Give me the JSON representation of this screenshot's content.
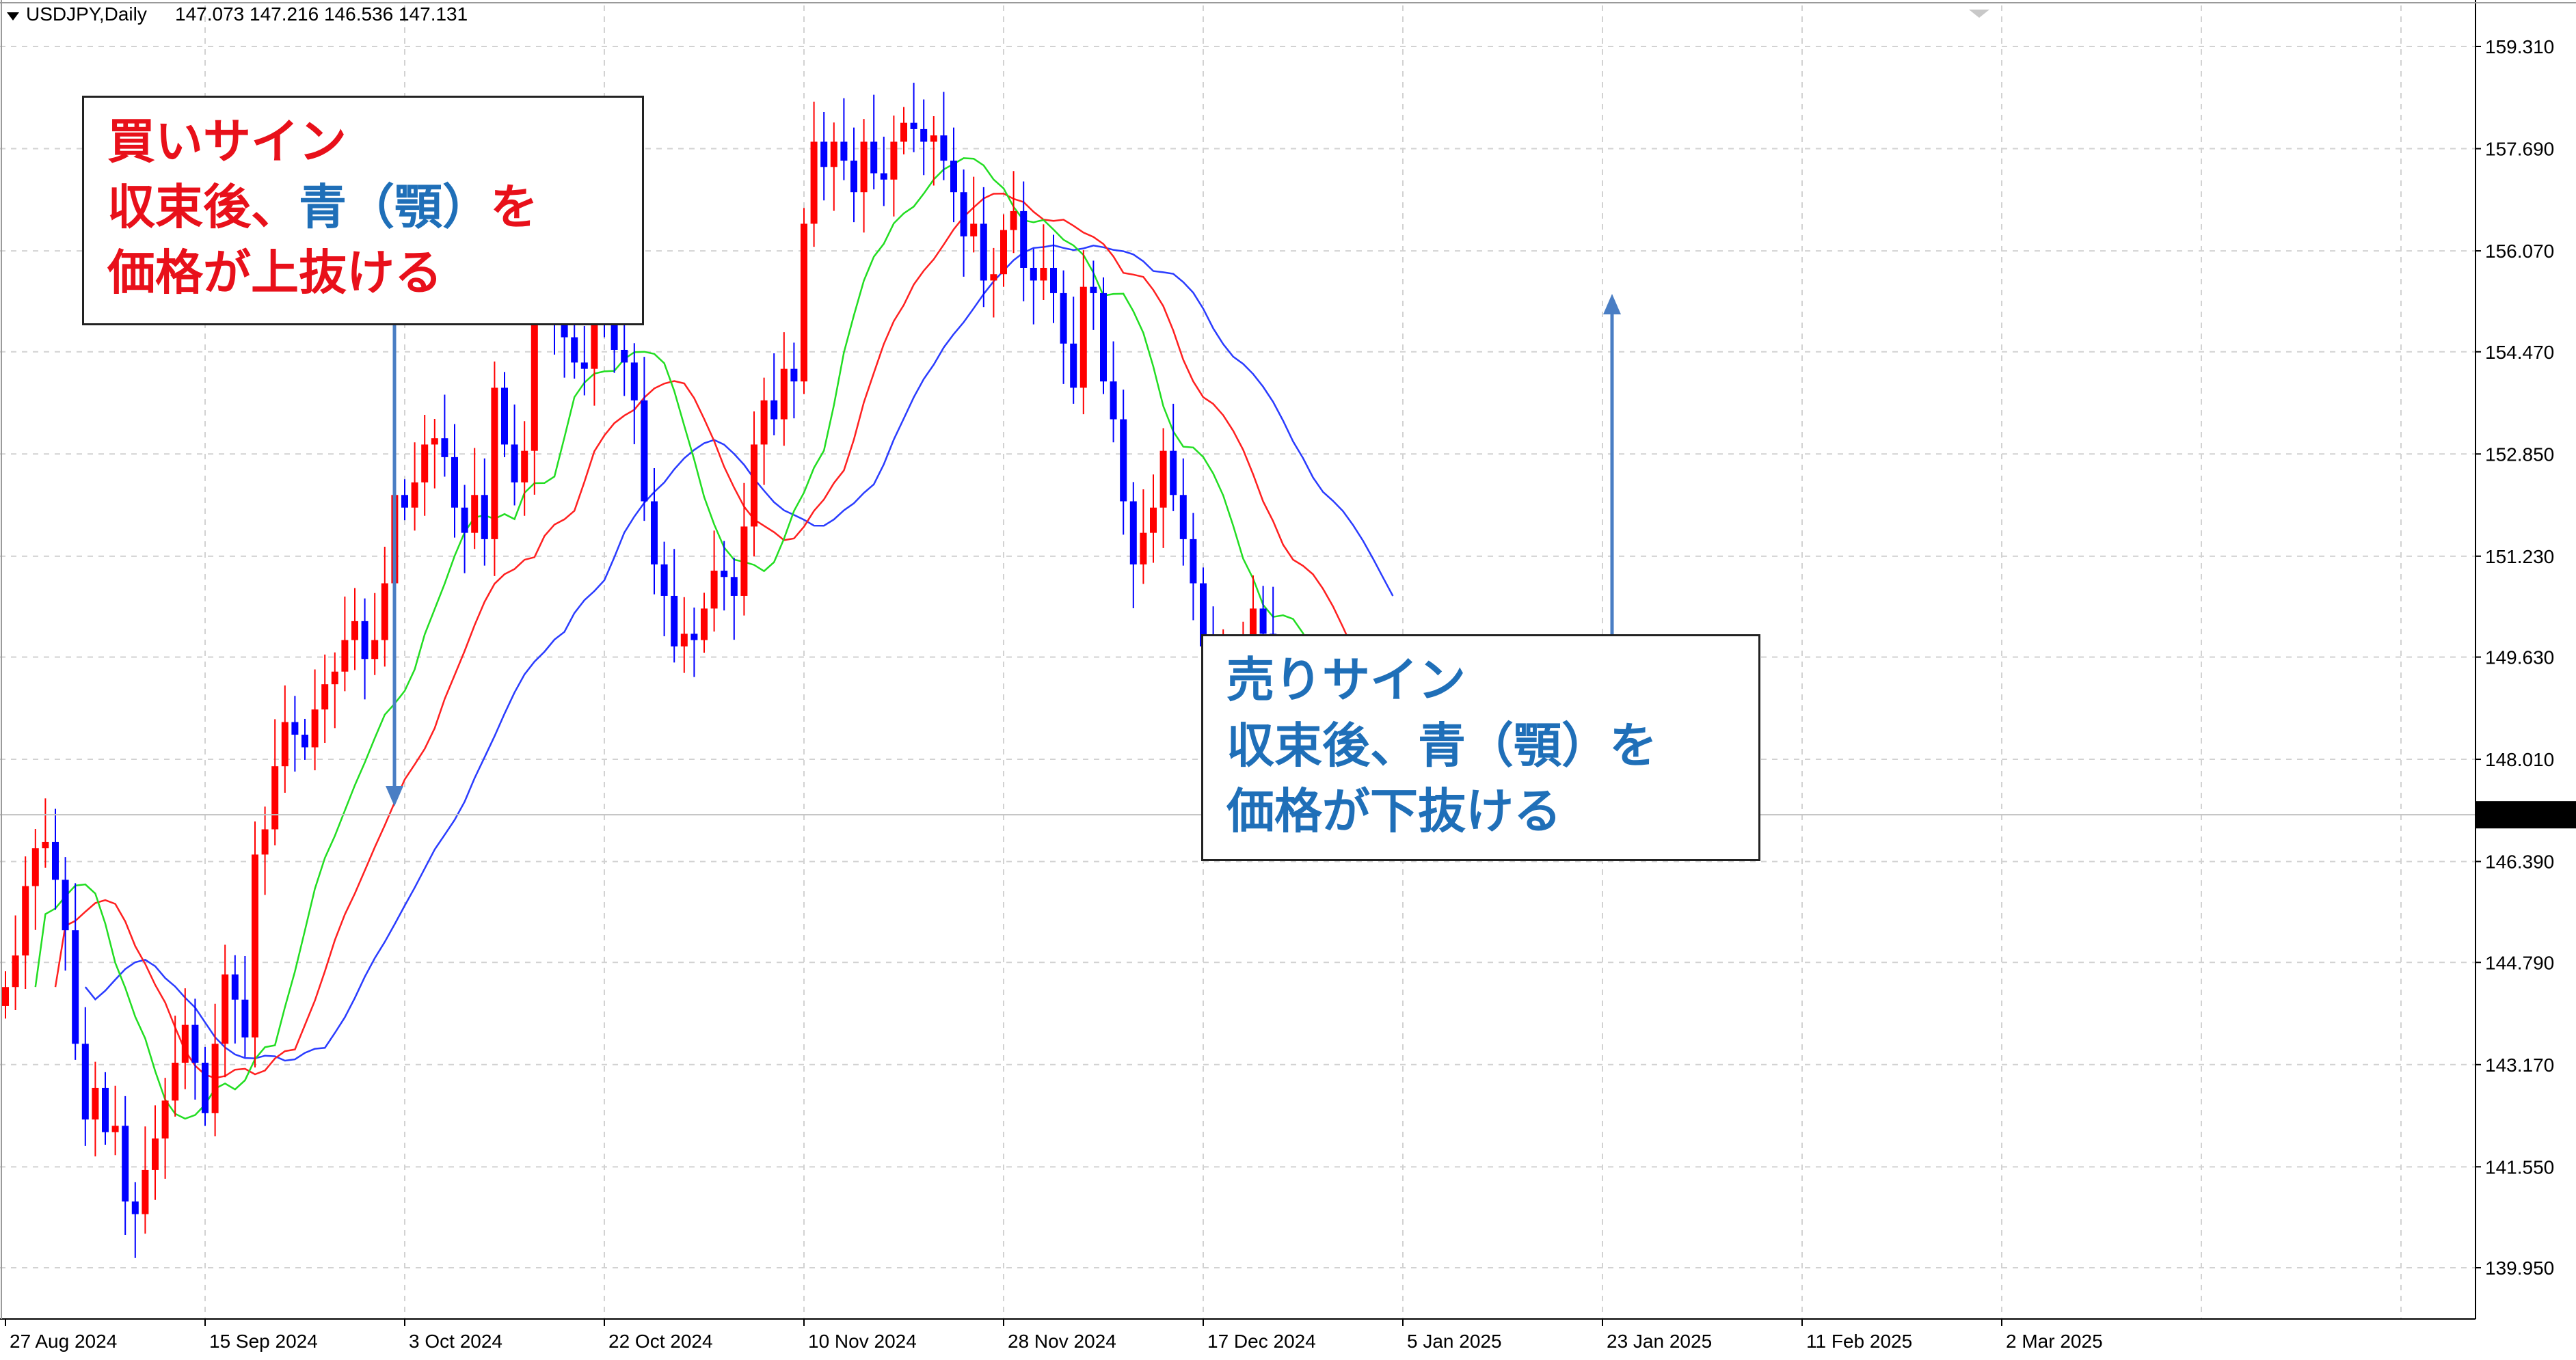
{
  "header": {
    "symbol": "USDJPY,Daily",
    "ohlc": "147.073 147.216 146.536 147.131"
  },
  "callouts": {
    "buy": {
      "line1": "買いサイン",
      "line2_a": "収束後、",
      "line2_b": "青（顎）",
      "line2_c": "を",
      "line3": "価格が上抜ける"
    },
    "sell": {
      "line1": "売りサイン",
      "line2": "収束後、青（顎）を",
      "line3": "価格が下抜ける"
    }
  },
  "colors": {
    "bull": "#ff0000",
    "bear": "#0000ff",
    "jaw": "#2a3cff",
    "teeth": "#ff2020",
    "lips": "#22dd22",
    "annotation_arrow": "#4a7ec4"
  },
  "chart_data": {
    "type": "candlestick",
    "indicator": "Alligator",
    "ylim": [
      139.2,
      160.0
    ],
    "y_ticks": [
      "159.310",
      "157.690",
      "156.070",
      "154.470",
      "152.850",
      "151.230",
      "149.630",
      "148.010",
      "146.390",
      "144.790",
      "143.170",
      "141.550",
      "139.950"
    ],
    "x_ticks": [
      "27 Aug 2024",
      "15 Sep 2024",
      "3 Oct 2024",
      "22 Oct 2024",
      "10 Nov 2024",
      "28 Nov 2024",
      "17 Dec 2024",
      "5 Jan 2025",
      "23 Jan 2025",
      "11 Feb 2025",
      "2 Mar 2025"
    ],
    "current_price": "147.131",
    "closes": [
      144.4,
      144.9,
      146.0,
      146.6,
      146.7,
      146.1,
      145.3,
      143.5,
      142.3,
      142.8,
      142.1,
      142.2,
      141.0,
      140.8,
      141.5,
      142.0,
      142.6,
      143.2,
      143.8,
      143.2,
      142.4,
      143.5,
      144.6,
      144.2,
      143.6,
      146.5,
      146.9,
      147.9,
      148.6,
      148.4,
      148.2,
      148.8,
      149.2,
      149.4,
      149.9,
      150.2,
      149.6,
      149.9,
      150.8,
      152.2,
      152.0,
      152.4,
      153.0,
      153.1,
      152.8,
      152.0,
      151.6,
      152.2,
      151.5,
      153.9,
      153.0,
      152.4,
      152.9,
      155.6,
      156.3,
      154.9,
      154.7,
      154.3,
      154.2,
      155.1,
      154.9,
      154.5,
      154.3,
      153.7,
      152.1,
      151.1,
      150.6,
      149.8,
      150.0,
      149.9,
      150.4,
      151.0,
      150.9,
      150.6,
      151.7,
      153.0,
      153.7,
      153.4,
      154.2,
      154.0,
      156.5,
      157.8,
      157.4,
      157.8,
      157.5,
      157.0,
      157.8,
      157.3,
      157.2,
      157.8,
      158.1,
      158.0,
      157.8,
      157.9,
      157.5,
      157.0,
      156.3,
      156.5,
      155.6,
      155.7,
      156.4,
      156.7,
      155.8,
      155.6,
      155.8,
      155.4,
      154.6,
      153.9,
      155.5,
      155.4,
      154.0,
      153.4,
      152.1,
      151.1,
      151.6,
      152.0,
      152.9,
      152.2,
      151.5,
      150.8,
      149.8,
      149.1,
      149.6,
      148.8,
      149.5,
      150.4,
      150.0,
      149.1,
      148.5,
      147.8,
      147.3,
      147.05
    ]
  }
}
